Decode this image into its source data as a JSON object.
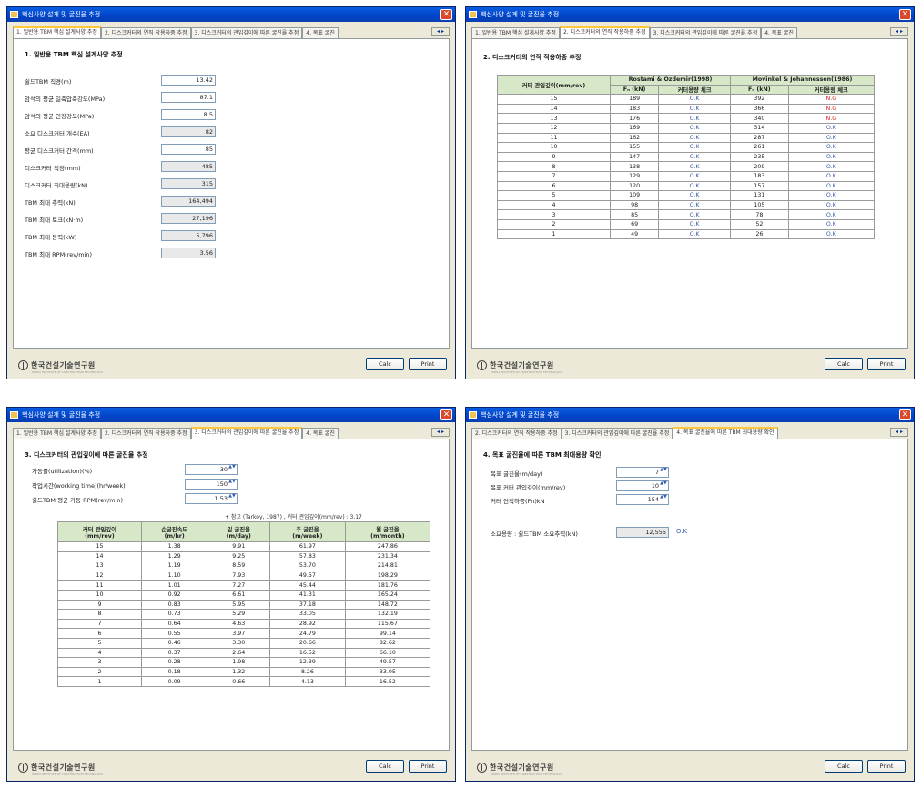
{
  "window_title": "핵심사양 설계 및 굴진율 추정",
  "tabs": [
    "1. 일반용 TBM 핵심 설계사양 추정",
    "2. 디스크커터의 연직 작용하중 추정",
    "3. 디스크커터의 관입깊이에 따른 굴진율 추정",
    "4. 목표 굴진율에 따른 TBM 최대용량 확인"
  ],
  "tabs_truncated": {
    "w1": [
      "1. 일반용 TBM 핵심 설계사양 추정",
      "2. 디스크커터의 연직 작용하중 추정",
      "3. 디스크커터의 관입깊이에 따른 굴진율 추정",
      "4. 목표 굴진"
    ],
    "w2": [
      "1. 일반용 TBM 핵심 설계사양 추정",
      "2. 디스크커터의 연직 작용하중 추정",
      "3. 디스크커터의 관입깊이에 따른 굴진율 추정",
      "4. 목표 굴진"
    ],
    "w3": [
      "1. 일반용 TBM 핵심 설계사양 추정",
      "2. 디스크커터의 연직 작용하중 추정",
      "3. 디스크커터의 관입깊이에 따른 굴진율 추정",
      "4. 목표 굴진"
    ],
    "w4": [
      "2. 디스크커터의 연직 작용하중 추정",
      "3. 디스크커터의 관입깊이에 따른 굴진율 추정",
      "4. 목표 굴진율에 따른 TBM 최대용량 확인"
    ]
  },
  "scroll_arrows": "◂ ▸",
  "buttons": {
    "calc": "Calc",
    "print": "Print"
  },
  "footer": {
    "logo_text": "한국건설기술연구원",
    "logo_sub": "KOREA INSTITUTE OF CONSTRUCTION TECHNOLOGY"
  },
  "close_glyph": "✕",
  "spin_arrows": "▲▼",
  "sec1": {
    "title": "1. 일반용 TBM 핵심 설계사양 추정",
    "fields": [
      {
        "label": "쉴드TBM 직경(m)",
        "value": "13.42",
        "readonly": false
      },
      {
        "label": "암석의 평균 일축압축강도(MPa)",
        "value": "87.1",
        "readonly": false
      },
      {
        "label": "암석의 평균 인장강도(MPa)",
        "value": "8.5",
        "readonly": false
      },
      {
        "label": "소요 디스크커터 개수(EA)",
        "value": "82",
        "readonly": true
      },
      {
        "label": "평균 디스크커터 간격(mm)",
        "value": "85",
        "readonly": false
      },
      {
        "label": "디스크커터 직경(mm)",
        "value": "485",
        "readonly": true
      },
      {
        "label": "디스크커터 최대용량(kN)",
        "value": "315",
        "readonly": true
      },
      {
        "label": "TBM 최대 추력(kN)",
        "value": "164,494",
        "readonly": true
      },
      {
        "label": "TBM 최대 토크(kN·m)",
        "value": "27,196",
        "readonly": true
      },
      {
        "label": "TBM 최대 동력(kW)",
        "value": "5,796",
        "readonly": true
      },
      {
        "label": "TBM 최대 RPM(rev/min)",
        "value": "3.56",
        "readonly": true
      }
    ]
  },
  "sec2": {
    "title": "2. 디스크커터의 연직 작용하중 추정",
    "col_penetration": "커터 관입깊이(mm/rev)",
    "group1": "Rostami & Ozdemir(1998)",
    "group2": "Movinkel & Johannessen(1986)",
    "fn_label": "Fₙ (kN)",
    "check_label": "커터용량 체크",
    "rows": [
      [
        "15",
        "189",
        "O.K",
        "392",
        "N.G"
      ],
      [
        "14",
        "183",
        "O.K",
        "366",
        "N.G"
      ],
      [
        "13",
        "176",
        "O.K",
        "340",
        "N.G"
      ],
      [
        "12",
        "169",
        "O.K",
        "314",
        "O.K"
      ],
      [
        "11",
        "162",
        "O.K",
        "287",
        "O.K"
      ],
      [
        "10",
        "155",
        "O.K",
        "261",
        "O.K"
      ],
      [
        "9",
        "147",
        "O.K",
        "235",
        "O.K"
      ],
      [
        "8",
        "138",
        "O.K",
        "209",
        "O.K"
      ],
      [
        "7",
        "129",
        "O.K",
        "183",
        "O.K"
      ],
      [
        "6",
        "120",
        "O.K",
        "157",
        "O.K"
      ],
      [
        "5",
        "109",
        "O.K",
        "131",
        "O.K"
      ],
      [
        "4",
        "98",
        "O.K",
        "105",
        "O.K"
      ],
      [
        "3",
        "85",
        "O.K",
        "78",
        "O.K"
      ],
      [
        "2",
        "69",
        "O.K",
        "52",
        "O.K"
      ],
      [
        "1",
        "49",
        "O.K",
        "26",
        "O.K"
      ]
    ]
  },
  "sec3": {
    "title": "3. 디스크커터의 관입깊이에 따른 굴진율 추정",
    "inputs": [
      {
        "label": "가동률(utilization)(%)",
        "value": "30"
      },
      {
        "label": "작업시간(working time)(hr/week)",
        "value": "150"
      },
      {
        "label": "쉴드TBM 평균 가동 RPM(rev/min)",
        "value": "1.53"
      }
    ],
    "note": "+ 참고 (Tarkoy, 1987) , 커터 관입깊이(mm/rev) : 3.17",
    "headers": [
      [
        "커터 관입깊이",
        "(mm/rev)"
      ],
      [
        "순굴진속도",
        "(m/hr)"
      ],
      [
        "일 굴진율",
        "(m/day)"
      ],
      [
        "주 굴진율",
        "(m/week)"
      ],
      [
        "월 굴진율",
        "(m/month)"
      ]
    ],
    "rows": [
      [
        "15",
        "1.38",
        "9.91",
        "61.97",
        "247.86"
      ],
      [
        "14",
        "1.29",
        "9.25",
        "57.83",
        "231.34"
      ],
      [
        "13",
        "1.19",
        "8.59",
        "53.70",
        "214.81"
      ],
      [
        "12",
        "1.10",
        "7.93",
        "49.57",
        "198.29"
      ],
      [
        "11",
        "1.01",
        "7.27",
        "45.44",
        "181.76"
      ],
      [
        "10",
        "0.92",
        "6.61",
        "41.31",
        "165.24"
      ],
      [
        "9",
        "0.83",
        "5.95",
        "37.18",
        "148.72"
      ],
      [
        "8",
        "0.73",
        "5.29",
        "33.05",
        "132.19"
      ],
      [
        "7",
        "0.64",
        "4.63",
        "28.92",
        "115.67"
      ],
      [
        "6",
        "0.55",
        "3.97",
        "24.79",
        "99.14"
      ],
      [
        "5",
        "0.46",
        "3.30",
        "20.66",
        "82.62"
      ],
      [
        "4",
        "0.37",
        "2.64",
        "16.52",
        "66.10"
      ],
      [
        "3",
        "0.28",
        "1.98",
        "12.39",
        "49.57"
      ],
      [
        "2",
        "0.18",
        "1.32",
        "8.26",
        "33.05"
      ],
      [
        "1",
        "0.09",
        "0.66",
        "4.13",
        "16.52"
      ]
    ]
  },
  "sec4": {
    "title": "4. 목표 굴진율에 따른 TBM 최대용량 확인",
    "inputs": [
      {
        "label": "목표 굴진율(m/day)",
        "value": "7"
      },
      {
        "label": "목표 커터 관입깊이(mm/rev)",
        "value": "10"
      },
      {
        "label": "커터 연직하중(Fn)kN",
        "value": "154"
      }
    ],
    "result_label": "소요용량 : 쉴드TBM 소요추력(kN)",
    "result_value": "12,555",
    "result_status": "O.K"
  }
}
